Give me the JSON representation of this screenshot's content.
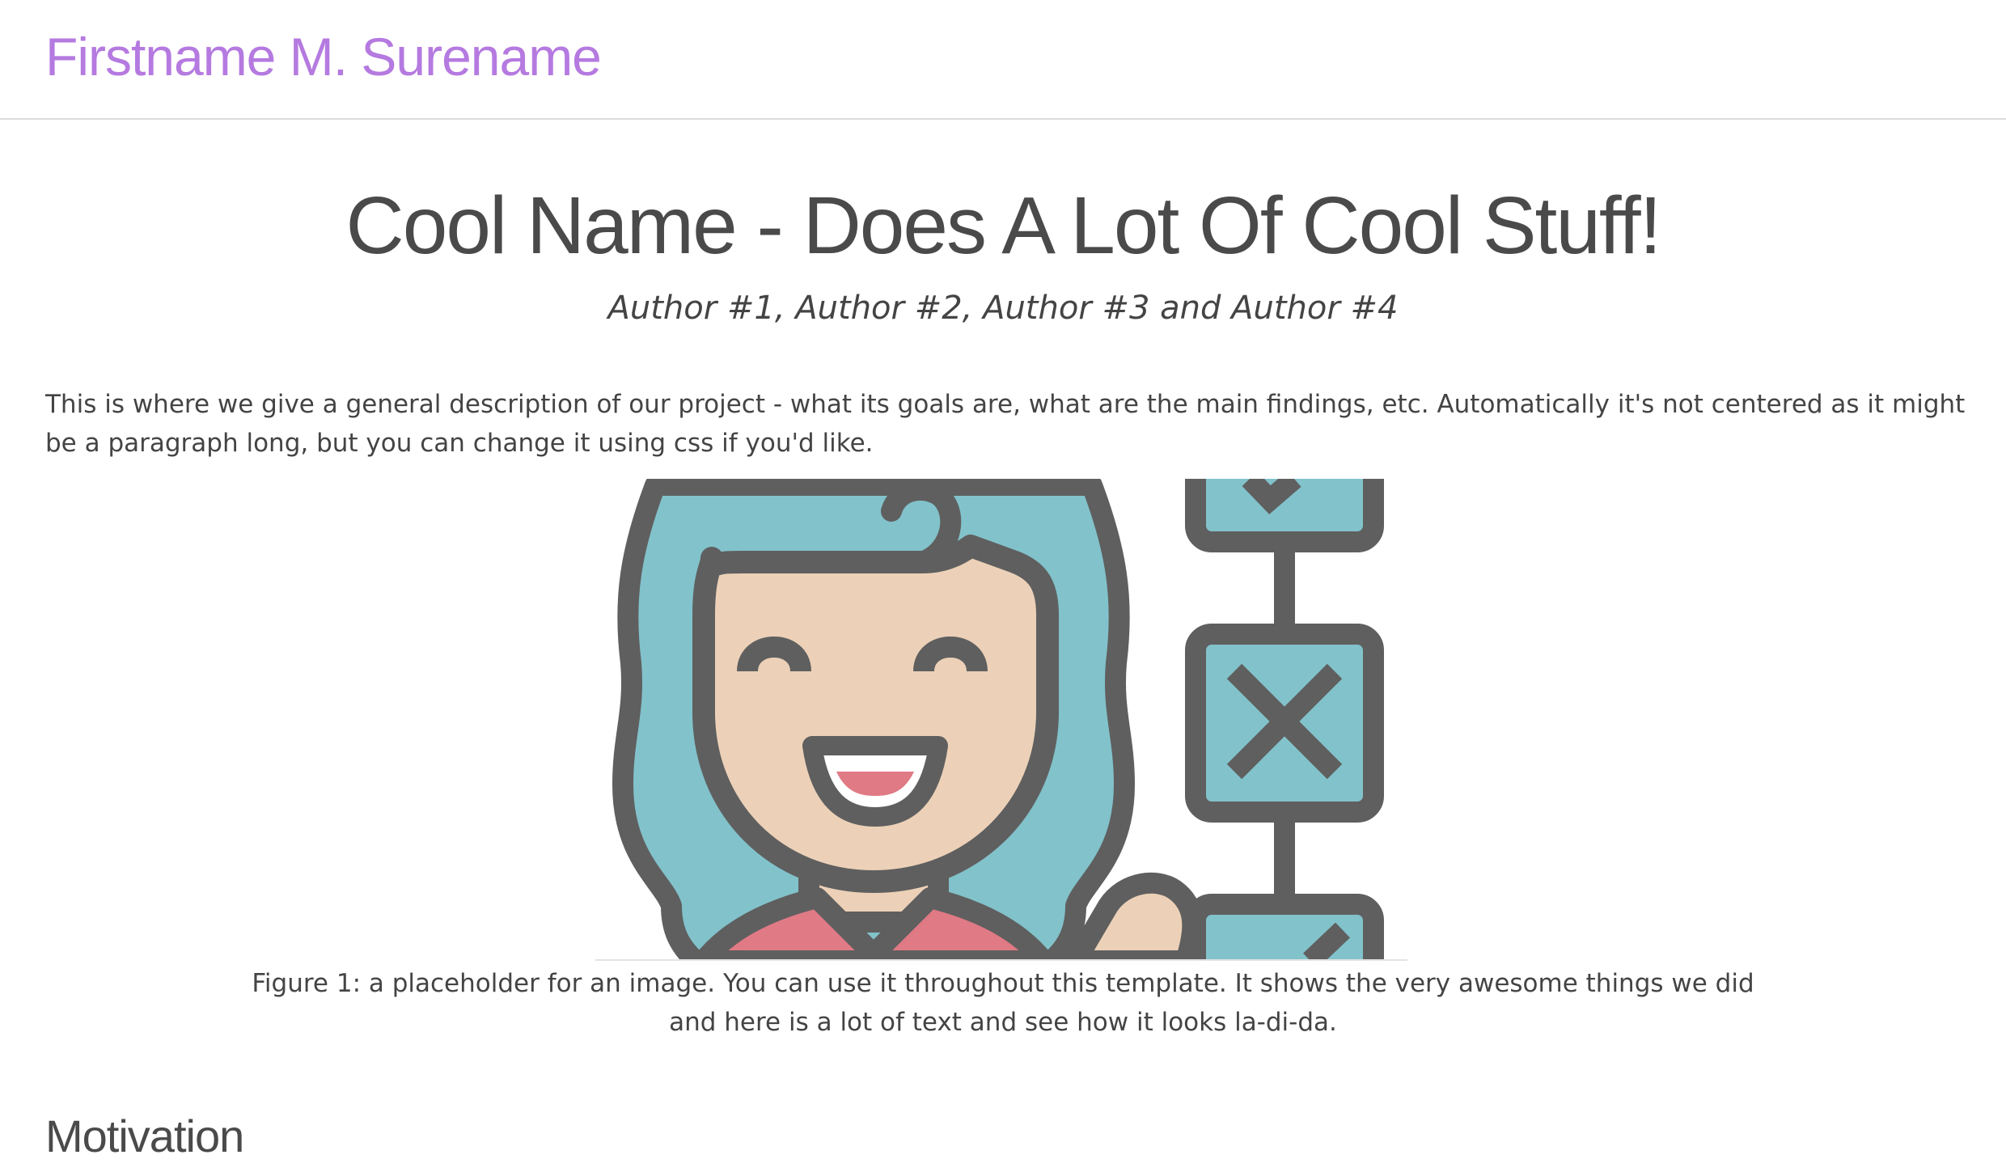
{
  "navbar": {
    "brand": "Firstname M. Surename"
  },
  "header": {
    "title": "Cool Name - Does A Lot Of Cool Stuff!",
    "authors": "Author #1, Author #2, Author #3 and Author #4"
  },
  "main": {
    "description": "This is where we give a general description of our project - what its goals are, what are the main findings, etc. Automatically it's not centered as it might be a paragraph long, but you can change it using css if you'd like.",
    "figure": {
      "icon": "girl-with-flowchart-illustration",
      "caption": "Figure 1: a placeholder for an image. You can use it throughout this template. It shows the very awesome things we did and here is a lot of text and see how it looks la-di-da."
    },
    "sections": [
      {
        "heading": "Motivation"
      }
    ]
  },
  "colors": {
    "brand": "#b57ae0",
    "hair": "#82c2cb",
    "skin": "#ecd1b8",
    "outline": "#5f5f5f",
    "mouth": "#e07a85",
    "shirt": "#e07a85"
  }
}
